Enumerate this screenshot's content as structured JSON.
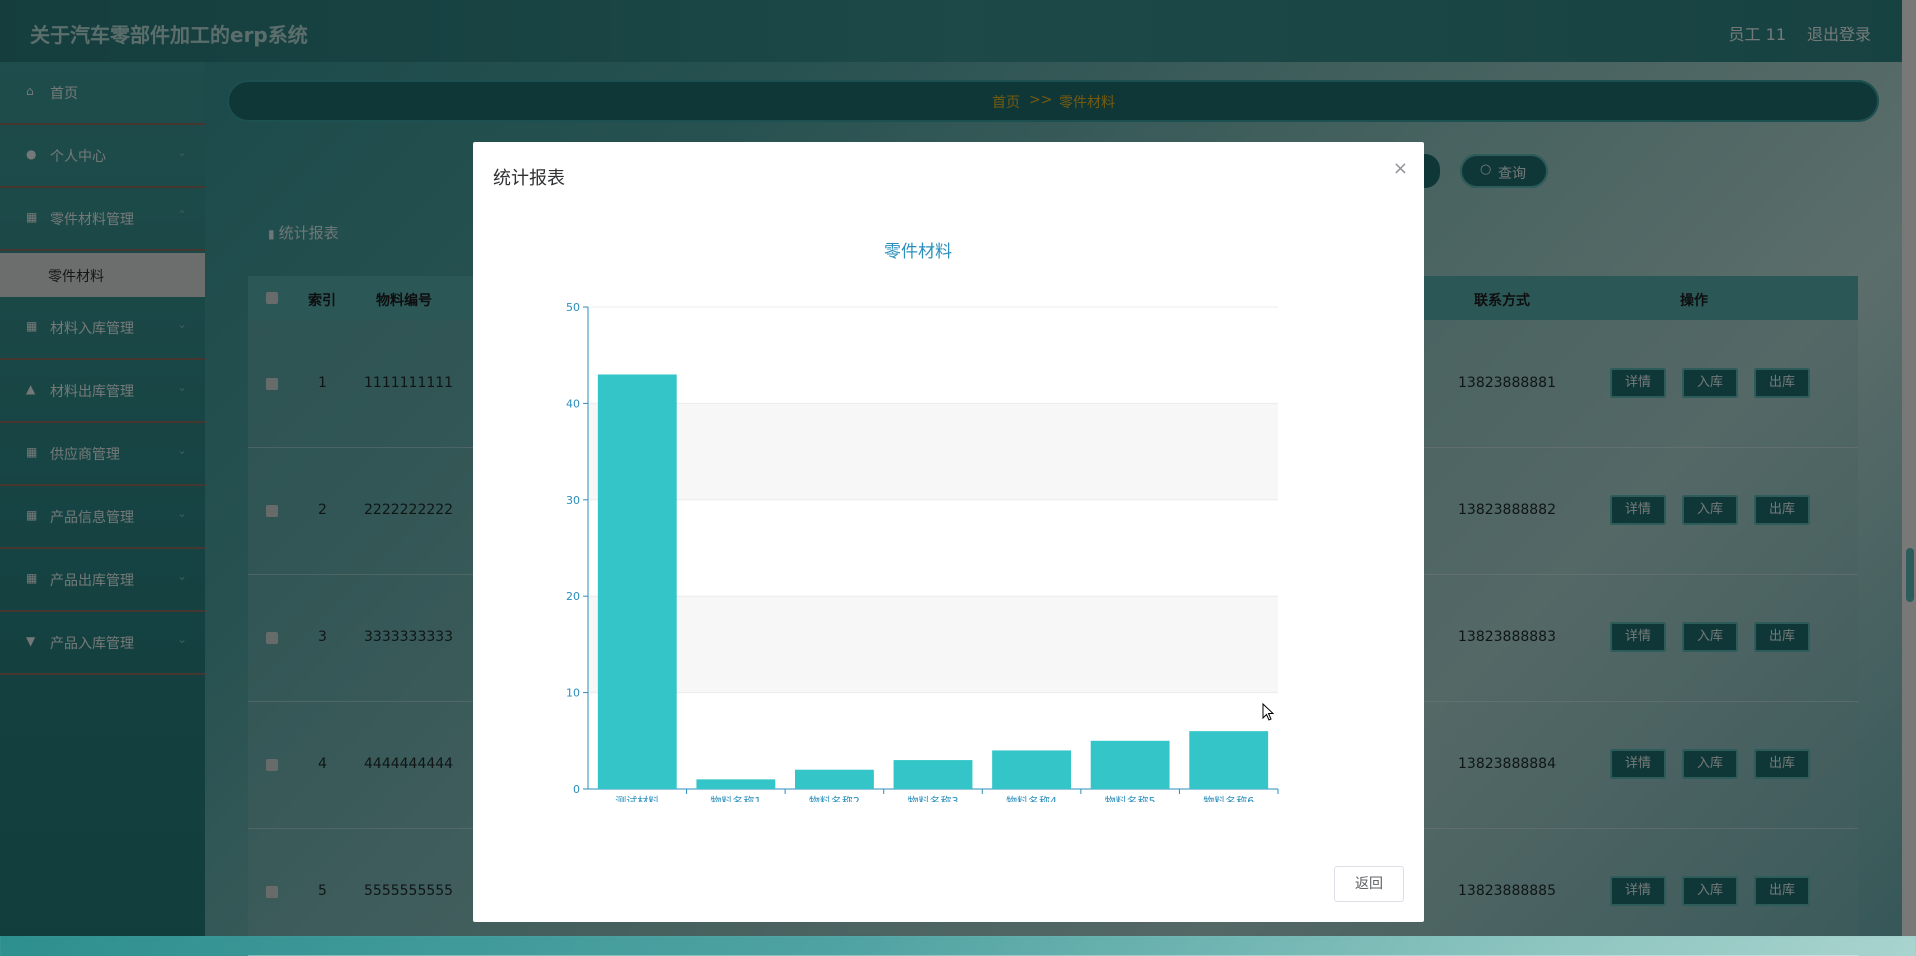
{
  "header": {
    "title": "关于汽车零部件加工的erp系统",
    "user": "员工 11",
    "logout": "退出登录"
  },
  "sidebar": {
    "items": [
      {
        "label": "首页",
        "icon": "home-icon"
      },
      {
        "label": "个人中心",
        "icon": "user-icon"
      },
      {
        "label": "零件材料管理",
        "icon": "grid-icon"
      },
      {
        "label": "材料入库管理",
        "icon": "grid-icon"
      },
      {
        "label": "材料出库管理",
        "icon": "thumb-icon"
      },
      {
        "label": "供应商管理",
        "icon": "grid-icon"
      },
      {
        "label": "产品信息管理",
        "icon": "grid-icon"
      },
      {
        "label": "产品出库管理",
        "icon": "grid-icon"
      },
      {
        "label": "产品入库管理",
        "icon": "cup-icon"
      }
    ],
    "active_sub": "零件材料"
  },
  "breadcrumb": {
    "home": "首页",
    "sep": ">>",
    "current": "零件材料"
  },
  "search": {
    "query_label": "查询"
  },
  "report_button": "统计报表",
  "table": {
    "headers": {
      "index": "索引",
      "code": "物料编号",
      "contact": "联系方式",
      "actions": "操作"
    },
    "rows": [
      {
        "index": "1",
        "code": "1111111111",
        "contact": "13823888881"
      },
      {
        "index": "2",
        "code": "2222222222",
        "contact": "13823888882"
      },
      {
        "index": "3",
        "code": "3333333333",
        "contact": "13823888883"
      },
      {
        "index": "4",
        "code": "4444444444",
        "contact": "13823888884"
      },
      {
        "index": "5",
        "code": "5555555555",
        "contact": "13823888885"
      }
    ],
    "action_labels": {
      "detail": "详情",
      "in": "入库",
      "out": "出库"
    }
  },
  "modal": {
    "title": "统计报表",
    "close": "×",
    "back_label": "返回"
  },
  "colors": {
    "bar": "#33c5c7",
    "axis": "#2a8fbd",
    "title": "#2a8fbd",
    "accent": "#1f6f70"
  },
  "chart_data": {
    "type": "bar",
    "title": "零件材料",
    "categories": [
      "测试材料",
      "物料名称1",
      "物料名称2",
      "物料名称3",
      "物料名称4",
      "物料名称5",
      "物料名称6"
    ],
    "values": [
      43,
      1,
      2,
      3,
      4,
      5,
      6
    ],
    "ylim": [
      0,
      50
    ],
    "yticks": [
      0,
      10,
      20,
      30,
      40,
      50
    ],
    "grid": true,
    "xlabel": "",
    "ylabel": ""
  }
}
